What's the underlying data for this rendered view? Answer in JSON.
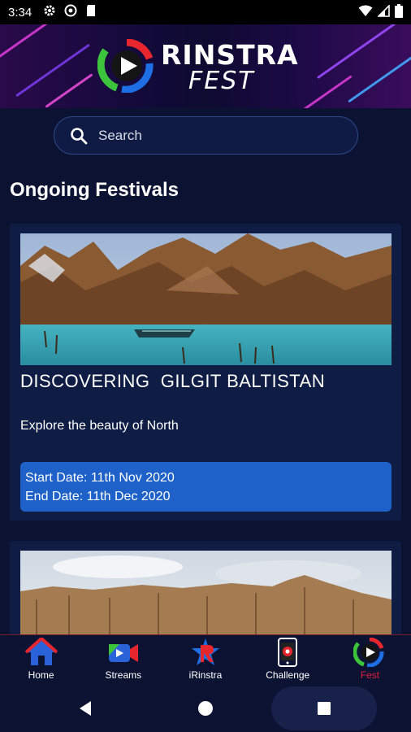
{
  "status_bar": {
    "time": "3:34"
  },
  "banner": {
    "brand_line1": "RINSTRA",
    "brand_line2": "FEST"
  },
  "search": {
    "placeholder": "Search"
  },
  "section": {
    "title": "Ongoing Festivals"
  },
  "festivals": [
    {
      "title": "DISCOVERING  GILGIT BALTISTAN",
      "description": "Explore the beauty of North",
      "start_date": "Start Date: 11th Nov 2020",
      "end_date": "End Date: 11th Dec 2020"
    }
  ],
  "bottom_nav": [
    {
      "label": "Home",
      "icon": "home-icon"
    },
    {
      "label": "Streams",
      "icon": "video-camera-icon"
    },
    {
      "label": "iRinstra",
      "icon": "irinstra-star-icon"
    },
    {
      "label": "Challenge",
      "icon": "phone-challenge-icon"
    },
    {
      "label": "Fest",
      "icon": "fest-play-icon",
      "active": true
    }
  ],
  "colors": {
    "background": "#0b1232",
    "card": "#0f1d45",
    "date_box": "#1e62c9",
    "active_nav": "#e0213a"
  }
}
